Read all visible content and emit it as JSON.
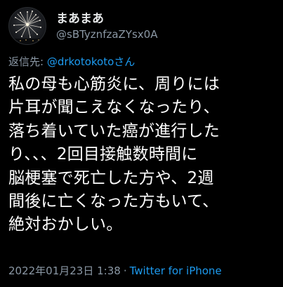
{
  "author": {
    "display_name": "まあまあ",
    "handle": "@sBTyznfzaZYsx0A",
    "avatar_icon": "firework-avatar-icon"
  },
  "reply": {
    "prefix": "返信先: ",
    "mention": "@drkotokotoさん"
  },
  "tweet": {
    "lines": [
      "私の母も心筋炎に、周りには",
      "片耳が聞こえなくなったり、",
      "落ち着いていた癌が進行した",
      "り、、、2回目接触数時間に",
      "脳梗塞で死亡した方や、2週",
      "間後に亡くなった方もいて、",
      "絶対おかしい。"
    ]
  },
  "meta": {
    "date": "2022年01月23日 1:38",
    "separator": "·",
    "source": "Twitter for iPhone"
  },
  "colors": {
    "background": "#000000",
    "text": "#ffffff",
    "secondary": "#8b98a5",
    "link": "#1d9bf0"
  }
}
